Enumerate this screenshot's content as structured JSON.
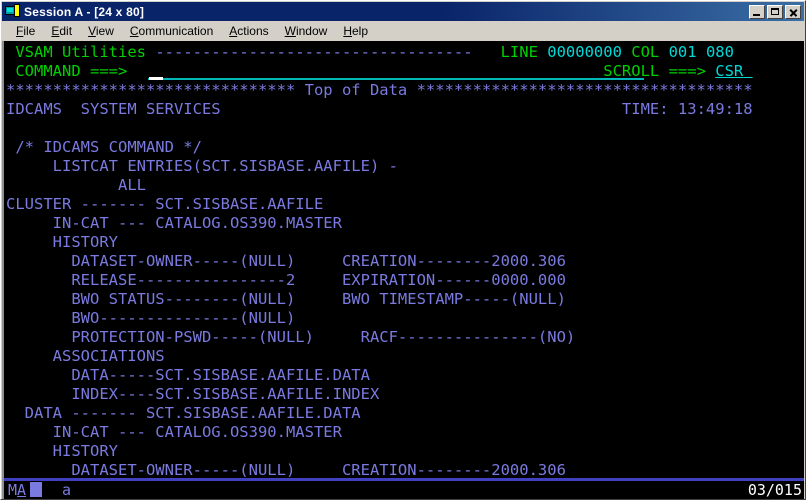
{
  "window": {
    "title": "Session A - [24 x 80]",
    "icon": "terminal-session-icon",
    "controls": {
      "minimize": "minimize-button",
      "maximize": "maximize-button",
      "close": "close-button"
    }
  },
  "menubar": {
    "items": [
      {
        "label": "File",
        "accel": "F"
      },
      {
        "label": "Edit",
        "accel": "E"
      },
      {
        "label": "View",
        "accel": "V"
      },
      {
        "label": "Communication",
        "accel": "C"
      },
      {
        "label": "Actions",
        "accel": "A"
      },
      {
        "label": "Window",
        "accel": "W"
      },
      {
        "label": "Help",
        "accel": "H"
      }
    ]
  },
  "colors": {
    "green": "#00d000",
    "cyan": "#00d8d8",
    "blue": "#7a7ae0",
    "white": "#ffffff",
    "background": "#000000",
    "titlebar": "#0a246a",
    "chrome": "#d4d0c8"
  },
  "terminal": {
    "columns": 80,
    "rows": 24,
    "header": {
      "panel_title": "VSAM Utilities",
      "dashes": "----------------------------------",
      "line_label": "LINE",
      "line_value": "00000000",
      "col_label": "COL",
      "col_value": "001",
      "col_end_value": "080",
      "command_label": "COMMAND ===>",
      "command_value": "",
      "scroll_label": "SCROLL ===>",
      "scroll_value": "CSR"
    },
    "top_of_data": {
      "left_stars": "*******************************",
      "label": "Top of Data",
      "right_stars": "************************************"
    },
    "product_line": {
      "name": "IDCAMS  SYSTEM SERVICES",
      "time_label": "TIME:",
      "time_value": "13:49:18"
    },
    "lines": [
      {
        "text": " /* IDCAMS COMMAND */",
        "color": "blue"
      },
      {
        "text": "     LISTCAT ENTRIES(SCT.SISBASE.AAFILE) -",
        "color": "blue"
      },
      {
        "text": "            ALL",
        "color": "blue"
      },
      {
        "text": "CLUSTER ------- SCT.SISBASE.AAFILE",
        "color": "blue"
      },
      {
        "text": "     IN-CAT --- CATALOG.OS390.MASTER",
        "color": "blue"
      },
      {
        "text": "     HISTORY",
        "color": "blue"
      },
      {
        "text": "       DATASET-OWNER-----(NULL)     CREATION--------2000.306",
        "color": "blue"
      },
      {
        "text": "       RELEASE----------------2     EXPIRATION------0000.000",
        "color": "blue"
      },
      {
        "text": "       BWO STATUS--------(NULL)     BWO TIMESTAMP-----(NULL)",
        "color": "blue"
      },
      {
        "text": "       BWO---------------(NULL)",
        "color": "blue"
      },
      {
        "text": "       PROTECTION-PSWD-----(NULL)     RACF---------------(NO)",
        "color": "blue"
      },
      {
        "text": "     ASSOCIATIONS",
        "color": "blue"
      },
      {
        "text": "       DATA-----SCT.SISBASE.AAFILE.DATA",
        "color": "blue"
      },
      {
        "text": "       INDEX----SCT.SISBASE.AAFILE.INDEX",
        "color": "blue"
      },
      {
        "text": "  DATA ------- SCT.SISBASE.AAFILE.DATA",
        "color": "blue"
      },
      {
        "text": "     IN-CAT --- CATALOG.OS390.MASTER",
        "color": "blue"
      },
      {
        "text": "     HISTORY",
        "color": "blue"
      },
      {
        "text": "       DATASET-OWNER-----(NULL)     CREATION--------2000.306",
        "color": "blue"
      }
    ]
  },
  "status_bar": {
    "machine_indicator": "MA",
    "machine_underline_char": "A",
    "input_inhibited_block": "cursor-block",
    "symbol": "a",
    "cursor_position": "03/015"
  }
}
